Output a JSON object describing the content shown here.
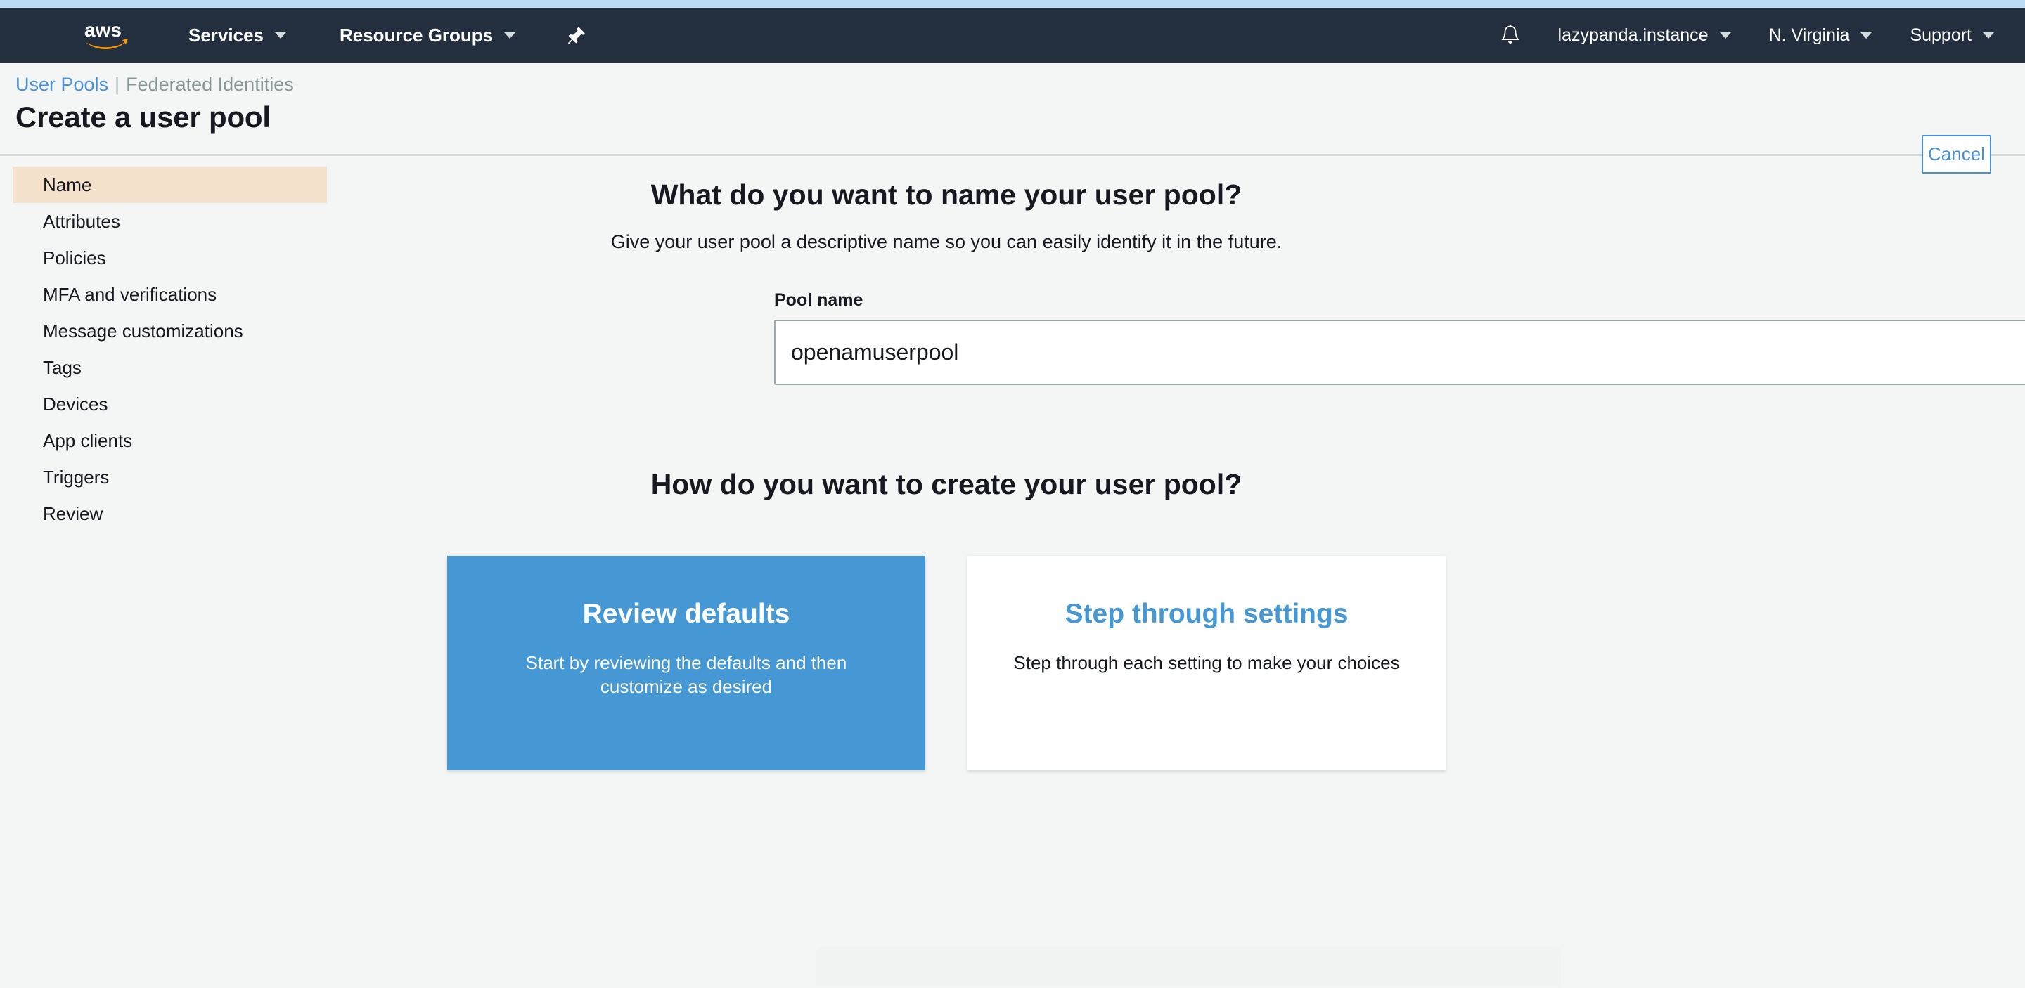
{
  "topnav": {
    "logo_alt": "aws",
    "left_items": [
      {
        "label": "Services",
        "icon": "chevron-down-icon"
      },
      {
        "label": "Resource Groups",
        "icon": "chevron-down-icon"
      }
    ],
    "pin_icon": "pushpin-icon",
    "bell_icon": "bell-icon",
    "right_items": [
      {
        "label": "lazypanda.instance",
        "icon": "chevron-down-icon"
      },
      {
        "label": "N. Virginia",
        "icon": "chevron-down-icon"
      },
      {
        "label": "Support",
        "icon": "chevron-down-icon"
      }
    ]
  },
  "header": {
    "breadcrumb_active": "User Pools",
    "breadcrumb_separator": "|",
    "breadcrumb_inactive": "Federated Identities",
    "title": "Create a user pool",
    "cancel_label": "Cancel"
  },
  "sidebar": {
    "items": [
      {
        "label": "Name",
        "active": true
      },
      {
        "label": "Attributes",
        "active": false
      },
      {
        "label": "Policies",
        "active": false
      },
      {
        "label": "MFA and verifications",
        "active": false
      },
      {
        "label": "Message customizations",
        "active": false
      },
      {
        "label": "Tags",
        "active": false
      },
      {
        "label": "Devices",
        "active": false
      },
      {
        "label": "App clients",
        "active": false
      },
      {
        "label": "Triggers",
        "active": false
      },
      {
        "label": "Review",
        "active": false
      }
    ]
  },
  "main": {
    "name_section": {
      "heading": "What do you want to name your user pool?",
      "subheading": "Give your user pool a descriptive name so you can easily identify it in the future.",
      "field_label": "Pool name",
      "field_value": "openamuserpool",
      "field_placeholder": ""
    },
    "create_section": {
      "heading": "How do you want to create your user pool?",
      "cards": [
        {
          "title": "Review defaults",
          "description": "Start by reviewing the defaults and then customize as desired",
          "style": "primary"
        },
        {
          "title": "Step through settings",
          "description": "Step through each setting to make your choices",
          "style": "secondary"
        }
      ]
    }
  },
  "colors": {
    "nav_background": "#232f3e",
    "top_strip": "#bfdcf5",
    "page_background": "#f4f6f6",
    "accent_blue": "#4598d3",
    "link_blue": "#4a90d9",
    "sidebar_active": "#f5e2cd",
    "aws_orange": "#ff9900"
  }
}
